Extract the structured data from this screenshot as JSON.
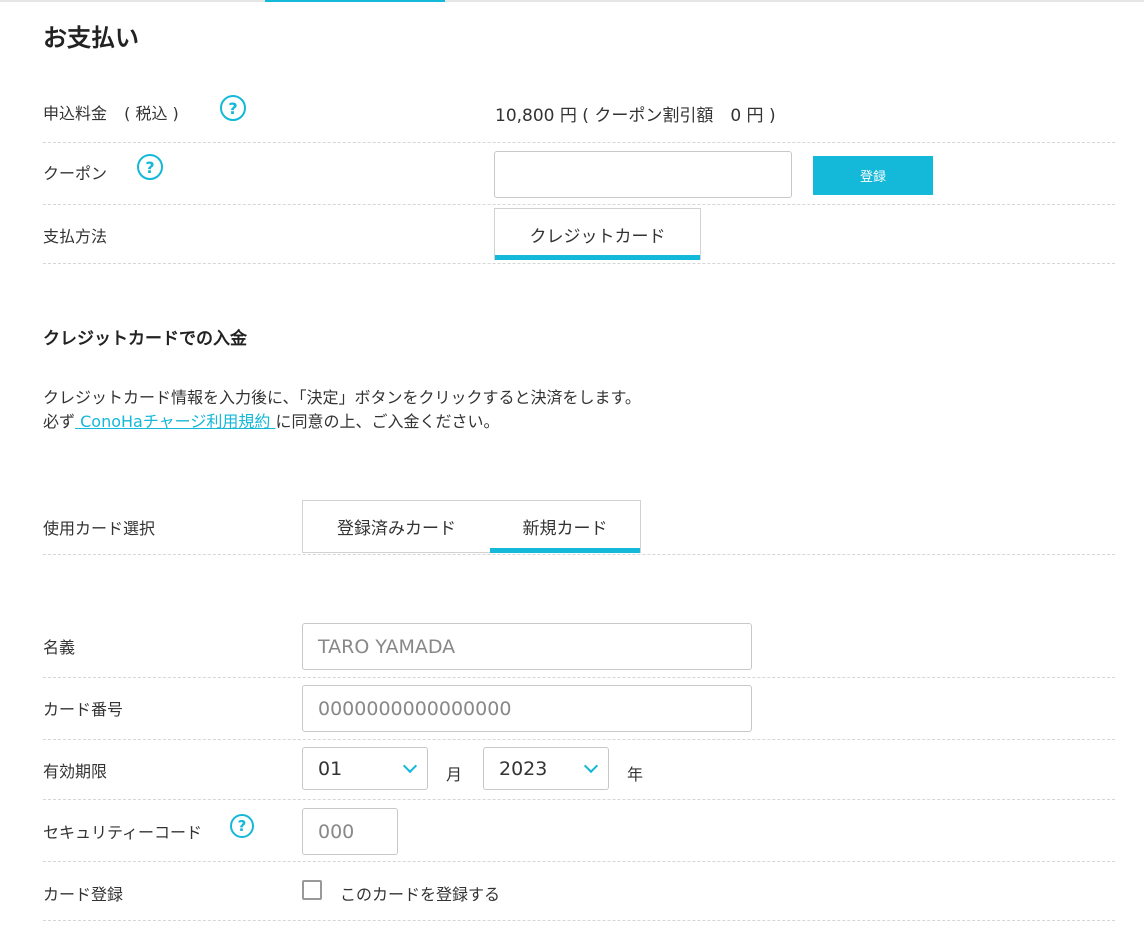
{
  "page_title": "お支払い",
  "fee": {
    "label": "申込料金",
    "tax_note": "( 税込 )",
    "amount": "10,800 円 ( クーポン割引額　0 円 )"
  },
  "coupon": {
    "label": "クーポン",
    "input_value": "",
    "submit_label": "登録"
  },
  "payment_method": {
    "label": "支払方法",
    "tabs": [
      "クレジットカード"
    ]
  },
  "credit_section": {
    "title": "クレジットカードでの入金",
    "desc_line1": "クレジットカード情報を入力後に、「決定」ボタンをクリックすると決済をします。",
    "desc_prefix": "必ず",
    "desc_link": " ConoHaチャージ利用規約 ",
    "desc_suffix": "に同意の上、ご入金ください。"
  },
  "card_select": {
    "label": "使用カード選択",
    "tabs": [
      "登録済みカード",
      "新規カード"
    ],
    "active_index": 1
  },
  "name_field": {
    "label": "名義",
    "placeholder": "TARO YAMADA"
  },
  "card_number": {
    "label": "カード番号",
    "placeholder": "0000000000000000"
  },
  "expiry": {
    "label": "有効期限",
    "month": "01",
    "month_unit": "月",
    "year": "2023",
    "year_unit": "年"
  },
  "security_code": {
    "label": "セキュリティーコード",
    "placeholder": "000"
  },
  "card_register": {
    "label": "カード登録",
    "checkbox_label": "このカードを登録する",
    "checked": false
  },
  "icons": {
    "help": "question-circle-icon",
    "dropdown": "chevron-down-icon"
  },
  "colors": {
    "accent": "#14b8d8",
    "text": "#333333",
    "border": "#c8c8c8"
  }
}
